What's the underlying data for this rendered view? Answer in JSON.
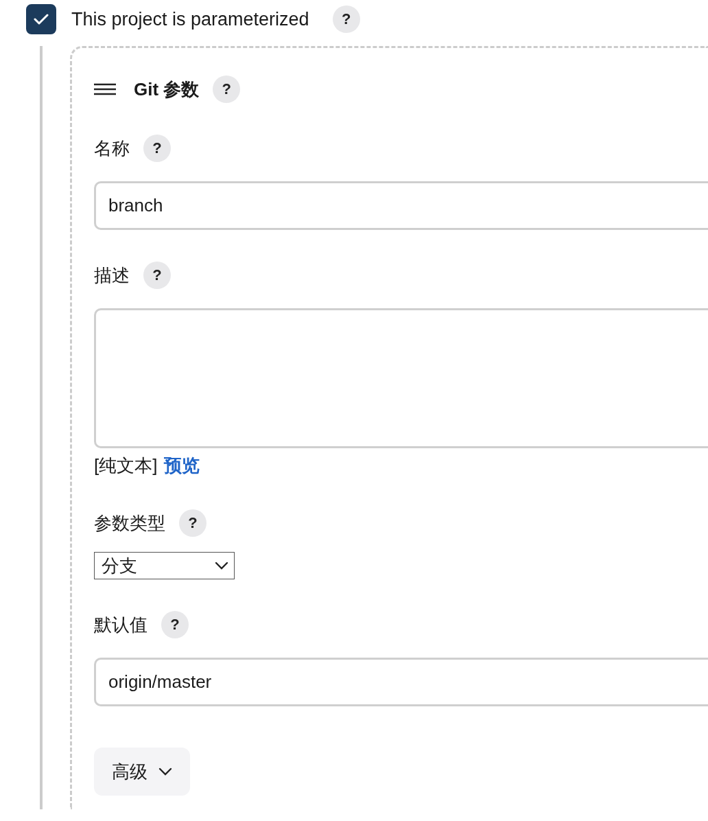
{
  "parameterized": {
    "label": "This project is parameterized",
    "checked": true,
    "help": "?"
  },
  "parameter": {
    "title": "Git 参数",
    "help": "?",
    "fields": [
      {
        "kind": "text",
        "label": "名称",
        "help": "?",
        "value": "branch"
      },
      {
        "kind": "textarea",
        "label": "描述",
        "help": "?",
        "format": "[纯文本]",
        "preview": "预览"
      },
      {
        "kind": "select",
        "label": "参数类型",
        "help": "?",
        "value": "分支"
      },
      {
        "kind": "text",
        "label": "默认值",
        "help": "?",
        "value": "origin/master"
      }
    ],
    "advanced": "高级"
  }
}
